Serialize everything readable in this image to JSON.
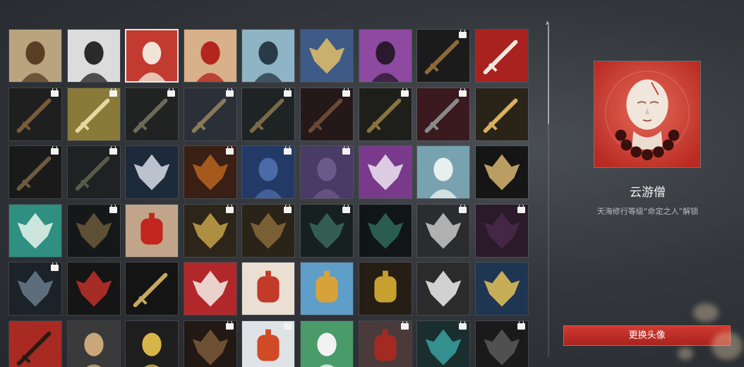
{
  "selected": {
    "name": "云游僧",
    "unlock_desc": "天海修行等级“命定之人”解锁",
    "button_label": "更换头像"
  },
  "avatars": [
    {
      "row": 0,
      "col": 0,
      "icon": "man-portrait-icon",
      "bg": "#b9a47f",
      "fg": "#5a3f25",
      "locked": false
    },
    {
      "row": 0,
      "col": 1,
      "icon": "hooded-woman-icon",
      "bg": "#dcdcdc",
      "fg": "#2a2a2a",
      "locked": false
    },
    {
      "row": 0,
      "col": 2,
      "icon": "monk-icon",
      "bg": "#c23a30",
      "fg": "#f1e3d6",
      "locked": false,
      "selected": true
    },
    {
      "row": 0,
      "col": 3,
      "icon": "masked-woman-icon",
      "bg": "#d8b08a",
      "fg": "#b3261e",
      "locked": false
    },
    {
      "row": 0,
      "col": 4,
      "icon": "noble-woman-icon",
      "bg": "#8fb4c6",
      "fg": "#2a3b48",
      "locked": false
    },
    {
      "row": 0,
      "col": 5,
      "icon": "ornate-deity-icon",
      "bg": "#3e5a86",
      "fg": "#e3c06a",
      "locked": false
    },
    {
      "row": 0,
      "col": 6,
      "icon": "purple-priestess-icon",
      "bg": "#8d4aa0",
      "fg": "#2b1a2f",
      "locked": false
    },
    {
      "row": 0,
      "col": 7,
      "icon": "sword-emblem-icon",
      "bg": "#1b1b1b",
      "fg": "#8a6a3a",
      "locked": true
    },
    {
      "row": 0,
      "col": 8,
      "icon": "crossed-katanas-icon",
      "bg": "#a9221f",
      "fg": "#f0e8e0",
      "locked": false
    },
    {
      "row": 1,
      "col": 0,
      "icon": "greatsword-icon",
      "bg": "#1f1f1f",
      "fg": "#7a5a38",
      "locked": true
    },
    {
      "row": 1,
      "col": 1,
      "icon": "bow-icon",
      "bg": "#8a7a3a",
      "fg": "#e6d8a0",
      "locked": true
    },
    {
      "row": 1,
      "col": 2,
      "icon": "crossbow-icon",
      "bg": "#202322",
      "fg": "#6e6a5a",
      "locked": true
    },
    {
      "row": 1,
      "col": 3,
      "icon": "launcher-icon",
      "bg": "#2b3038",
      "fg": "#8a7a5a",
      "locked": true
    },
    {
      "row": 1,
      "col": 4,
      "icon": "gun-icon",
      "bg": "#1e2324",
      "fg": "#7a6a4a",
      "locked": true
    },
    {
      "row": 1,
      "col": 5,
      "icon": "rifle-icon",
      "bg": "#241818",
      "fg": "#6a4a35",
      "locked": true
    },
    {
      "row": 1,
      "col": 6,
      "icon": "cannon-icon",
      "bg": "#1e1f1b",
      "fg": "#8a7340",
      "locked": true
    },
    {
      "row": 1,
      "col": 7,
      "icon": "hand-cannon-icon",
      "bg": "#3a1a1e",
      "fg": "#8a8a8a",
      "locked": true
    },
    {
      "row": 1,
      "col": 8,
      "icon": "spear-icon",
      "bg": "#2a2418",
      "fg": "#d8b060",
      "locked": false
    },
    {
      "row": 2,
      "col": 0,
      "icon": "dagger-icon",
      "bg": "#1a1a1a",
      "fg": "#6e5a40",
      "locked": true
    },
    {
      "row": 2,
      "col": 1,
      "icon": "mace-icon",
      "bg": "#1e2222",
      "fg": "#5a5a4a",
      "locked": true
    },
    {
      "row": 2,
      "col": 2,
      "icon": "dragon-mask-icon",
      "bg": "#1d2a3a",
      "fg": "#d7dde8",
      "locked": false
    },
    {
      "row": 2,
      "col": 3,
      "icon": "dragon-icon",
      "bg": "#3a1f14",
      "fg": "#b9641e",
      "locked": true
    },
    {
      "row": 2,
      "col": 4,
      "icon": "blue-profile-icon",
      "bg": "#233a66",
      "fg": "#4b6aa8",
      "locked": true
    },
    {
      "row": 2,
      "col": 5,
      "icon": "purple-profile-icon",
      "bg": "#4a3a66",
      "fg": "#6a5a8a",
      "locked": true
    },
    {
      "row": 2,
      "col": 6,
      "icon": "serpent-sword-icon",
      "bg": "#7a3a8c",
      "fg": "#efe6f0",
      "locked": false
    },
    {
      "row": 2,
      "col": 7,
      "icon": "leaping-warrior-icon",
      "bg": "#78a2b0",
      "fg": "#e8f0ef",
      "locked": false
    },
    {
      "row": 2,
      "col": 8,
      "icon": "vajra-icon",
      "bg": "#151515",
      "fg": "#d6b570",
      "locked": false
    },
    {
      "row": 3,
      "col": 0,
      "icon": "green-lotus-icon",
      "bg": "#2f8f80",
      "fg": "#e8f6ef",
      "locked": false
    },
    {
      "row": 3,
      "col": 1,
      "icon": "dark-lotus-icon",
      "bg": "#151819",
      "fg": "#6a5a3a",
      "locked": true
    },
    {
      "row": 3,
      "col": 2,
      "icon": "lantern-seal-icon",
      "bg": "#c0a58a",
      "fg": "#c2261f",
      "locked": false
    },
    {
      "row": 3,
      "col": 3,
      "icon": "gold-crest-icon",
      "bg": "#2d2519",
      "fg": "#c6a24a",
      "locked": true
    },
    {
      "row": 3,
      "col": 4,
      "icon": "eagle-crest-icon",
      "bg": "#2a2418",
      "fg": "#8a6a3a",
      "locked": true
    },
    {
      "row": 3,
      "col": 5,
      "icon": "teal-flame-icon",
      "bg": "#16201f",
      "fg": "#3a6a5a",
      "locked": true
    },
    {
      "row": 3,
      "col": 6,
      "icon": "green-flame-icon",
      "bg": "#101615",
      "fg": "#2f6a57",
      "locked": false
    },
    {
      "row": 3,
      "col": 7,
      "icon": "hex-symbol-icon",
      "bg": "#2a2c2e",
      "fg": "#c8c8c8",
      "locked": true
    },
    {
      "row": 3,
      "col": 8,
      "icon": "purple-mask-icon",
      "bg": "#2a1a2a",
      "fg": "#4a2a4a",
      "locked": true
    },
    {
      "row": 4,
      "col": 0,
      "icon": "cloud-swirl-icon",
      "bg": "#1b2228",
      "fg": "#6a7a8a",
      "locked": true
    },
    {
      "row": 4,
      "col": 1,
      "icon": "red-lotus-icon",
      "bg": "#161515",
      "fg": "#c0302a",
      "locked": false
    },
    {
      "row": 4,
      "col": 2,
      "icon": "arrow-circle-icon",
      "bg": "#141414",
      "fg": "#c8a860",
      "locked": false
    },
    {
      "row": 4,
      "col": 3,
      "icon": "paper-crane-icon",
      "bg": "#b2282a",
      "fg": "#f3efe8",
      "locked": false
    },
    {
      "row": 4,
      "col": 4,
      "icon": "umbrella-icon",
      "bg": "#eadfd2",
      "fg": "#c23a2a",
      "locked": false
    },
    {
      "row": 4,
      "col": 5,
      "icon": "gourd-icon",
      "bg": "#5e9ec8",
      "fg": "#d7a23a",
      "locked": false
    },
    {
      "row": 4,
      "col": 6,
      "icon": "coin-tassel-icon",
      "bg": "#241e14",
      "fg": "#c8a030",
      "locked": false
    },
    {
      "row": 4,
      "col": 7,
      "icon": "half-mask-icon",
      "bg": "#2b2b2b",
      "fg": "#eeeeee",
      "locked": false
    },
    {
      "row": 4,
      "col": 8,
      "icon": "gold-mask-icon",
      "bg": "#1f3652",
      "fg": "#e6c25a",
      "locked": false
    },
    {
      "row": 5,
      "col": 0,
      "icon": "flute-icon",
      "bg": "#a82a22",
      "fg": "#2a1a14",
      "locked": false
    },
    {
      "row": 5,
      "col": 1,
      "icon": "warrior-icon",
      "bg": "#3a3a3a",
      "fg": "#c8a87a",
      "locked": false
    },
    {
      "row": 5,
      "col": 2,
      "icon": "gold-bust-icon",
      "bg": "#1e1e1e",
      "fg": "#d6b54a",
      "locked": false
    },
    {
      "row": 5,
      "col": 3,
      "icon": "toad-icon",
      "bg": "#221814",
      "fg": "#7a5a3a",
      "locked": true
    },
    {
      "row": 5,
      "col": 4,
      "icon": "red-lantern-icon",
      "bg": "#dfe3e6",
      "fg": "#d04a26",
      "locked": true
    },
    {
      "row": 5,
      "col": 5,
      "icon": "panda-icon",
      "bg": "#4a9a6a",
      "fg": "#f2f2f2",
      "locked": false
    },
    {
      "row": 5,
      "col": 6,
      "icon": "red-pot-icon",
      "bg": "#4a3a3a",
      "fg": "#a32a22",
      "locked": true
    },
    {
      "row": 5,
      "col": 7,
      "icon": "teal-beast-icon",
      "bg": "#1a2e2e",
      "fg": "#3aa0a0",
      "locked": true
    },
    {
      "row": 5,
      "col": 8,
      "icon": "dark-wings-icon",
      "bg": "#1a1a1a",
      "fg": "#5a5a5a",
      "locked": true
    }
  ],
  "colors": {
    "accent": "#c0302a",
    "preview_bg": "#c64036"
  }
}
